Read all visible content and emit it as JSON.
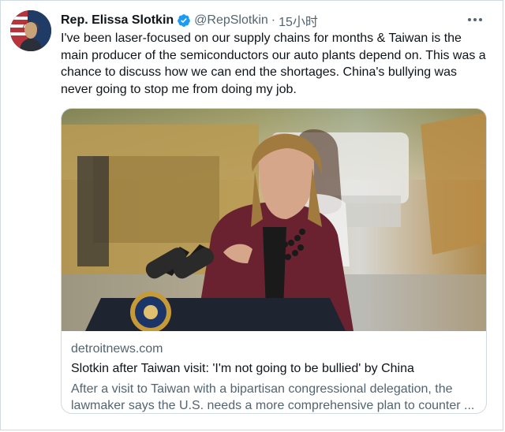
{
  "tweet": {
    "display_name": "Rep. Elissa Slotkin",
    "handle": "@RepSlotkin",
    "separator": "·",
    "time": "15小时",
    "text": "I've been laser-focused on our supply chains for months & Taiwan is the main producer of the semiconductors our auto plants depend on. This was a chance to discuss how we can end the shortages. China's bullying was never going to stop me from doing my job.",
    "more_icon": "more-horizontal-icon",
    "verified_icon": "verified-badge-icon",
    "verified_color": "#1d9bf0"
  },
  "card": {
    "domain": "detroitnews.com",
    "title": "Slotkin after Taiwan visit: 'I'm not going to be bullied' by China",
    "description": "After a visit to Taiwan with a bipartisan congressional delegation, the lawmaker says the U.S. needs a more comprehensive plan to counter ..."
  },
  "colors": {
    "text_primary": "#0f1419",
    "text_secondary": "#536471",
    "border": "#cfd9de",
    "accent": "#1d9bf0"
  }
}
